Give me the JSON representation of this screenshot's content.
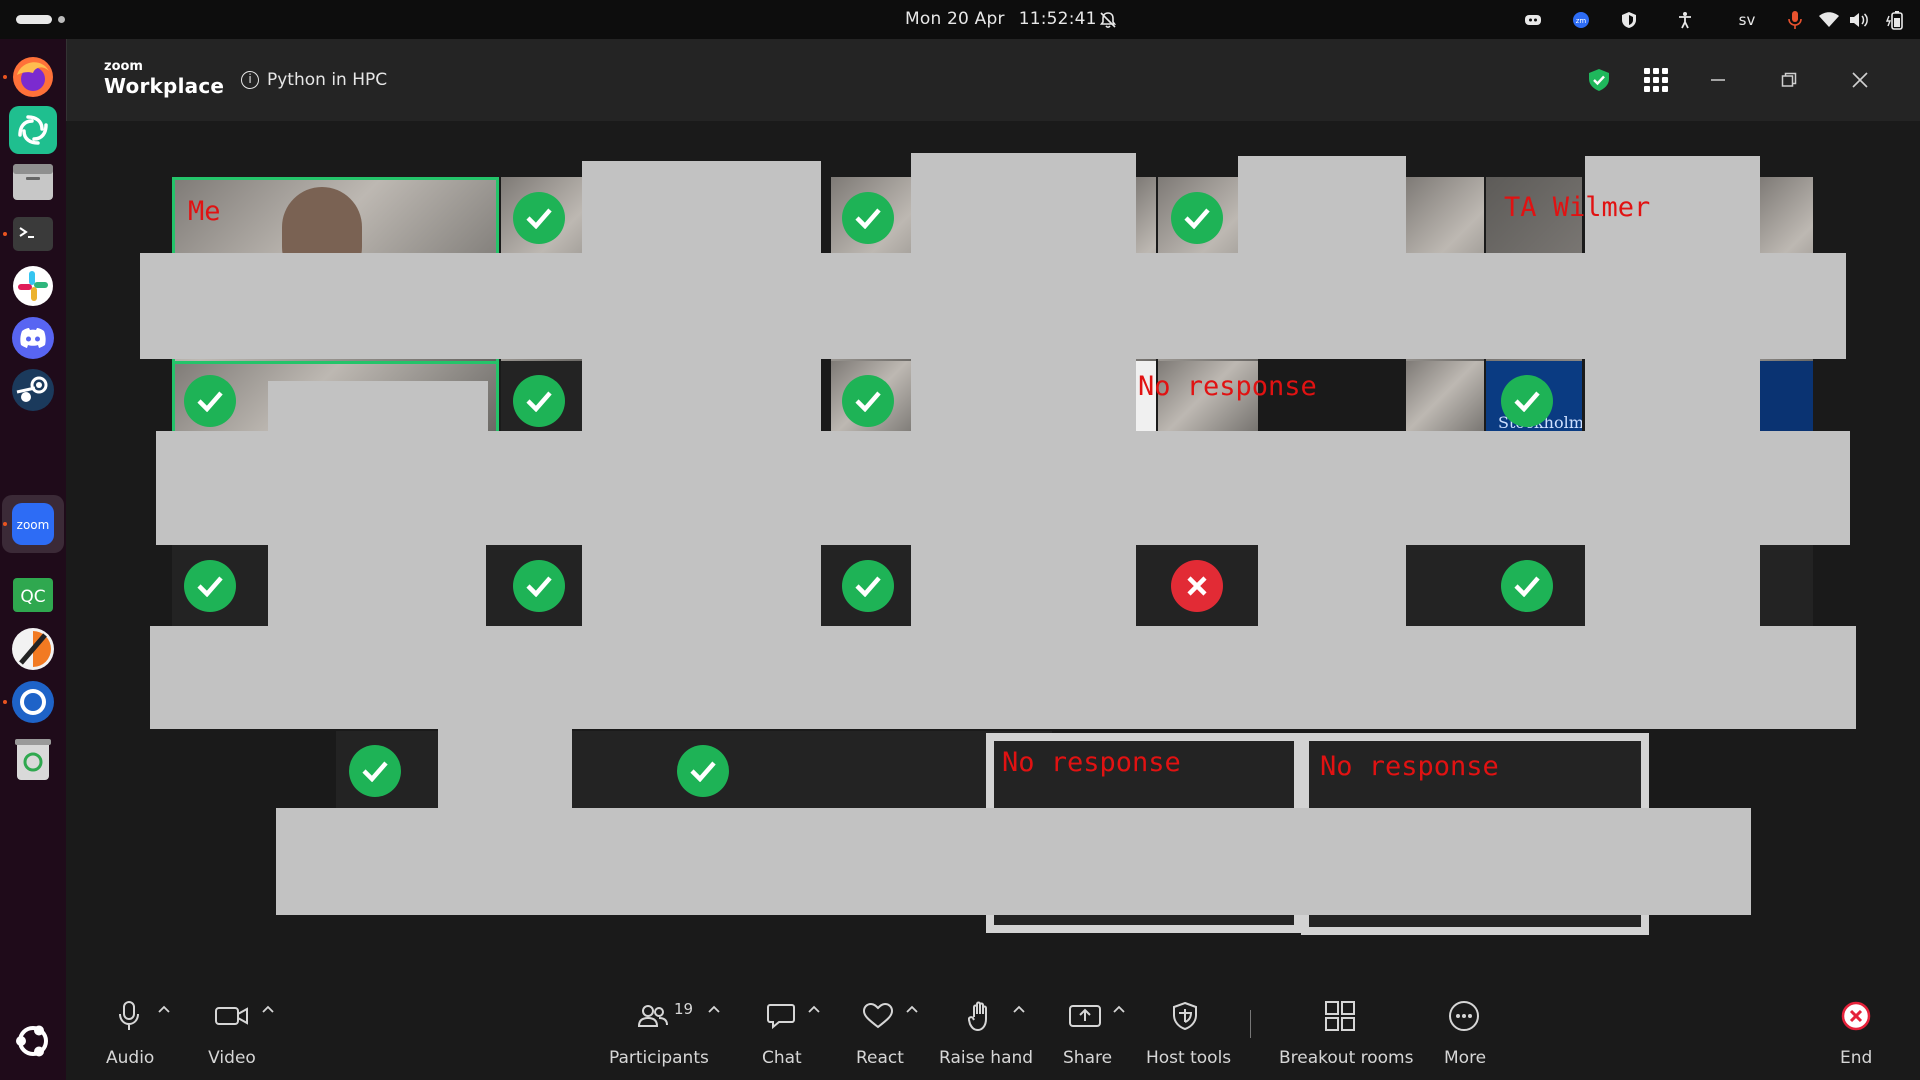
{
  "system": {
    "date": "Mon 20 Apr",
    "time": "11:52:41",
    "keyboard_layout": "sv"
  },
  "zoom": {
    "brand_small": "zoom",
    "brand_big": "Workplace",
    "meeting_title": "Python in HPC"
  },
  "tiles": {
    "me_label": "Me",
    "ta_label": "TA Wilmer",
    "no_response_1": "No response",
    "no_response_2": "No response",
    "no_response_3": "No response",
    "stockholm_text": "Stockholm"
  },
  "toolbar": {
    "audio": "Audio",
    "video": "Video",
    "participants": "Participants",
    "participants_count": "19",
    "chat": "Chat",
    "react": "React",
    "raise_hand": "Raise hand",
    "share": "Share",
    "host_tools": "Host tools",
    "breakout_rooms": "Breakout rooms",
    "more": "More",
    "end": "End"
  },
  "colors": {
    "check_green": "#1eb356",
    "cross_red": "#e22b35",
    "label_red": "#e11212",
    "speaker_outline": "#24c46a",
    "end_red": "#e5223a"
  }
}
